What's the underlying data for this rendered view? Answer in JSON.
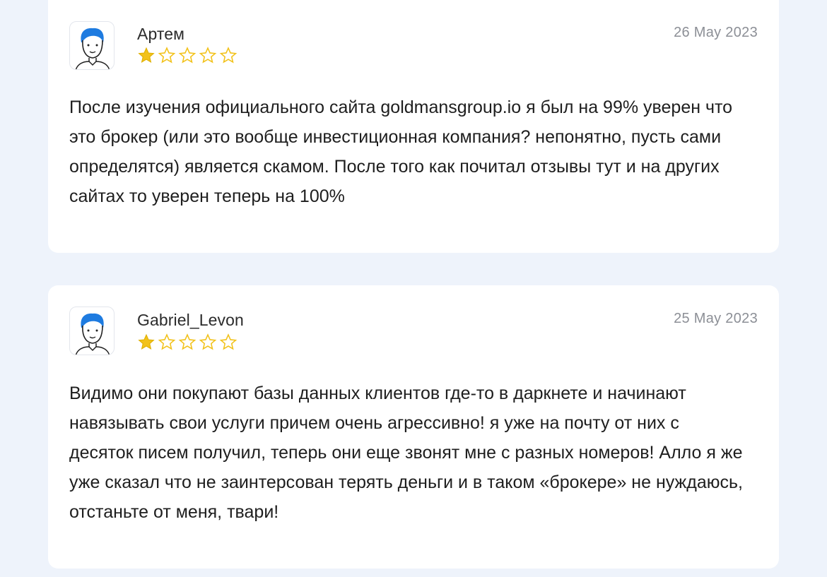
{
  "reviews": [
    {
      "author": "Артем",
      "date": "26 May 2023",
      "rating": 1,
      "max_rating": 5,
      "text": "После изучения официального сайта goldmansgroup.io я был на 99% уверен что это брокер (или это вообще инвестиционная компания? непонятно, пусть сами определятся) является скамом. После того как почитал отзывы тут и на других сайтах то уверен теперь на 100%"
    },
    {
      "author": "Gabriel_Levon",
      "date": "25 May 2023",
      "rating": 1,
      "max_rating": 5,
      "text": "Видимо они покупают базы данных клиентов где-то в даркнете и начинают навязывать свои услуги причем очень агрессивно! я уже на почту от них с десяток писем получил, теперь они еще звонят мне с разных номеров! Алло я же уже сказал что не заинтерсован терять деньги и в таком «брокере» не нуждаюсь, отстаньте от меня, твари!"
    }
  ],
  "icons": {
    "avatar": "user-avatar-icon",
    "star_filled": "star-filled-icon",
    "star_empty": "star-outline-icon"
  },
  "colors": {
    "page_background": "#eef3fb",
    "card_background": "#ffffff",
    "star": "#f2c21b",
    "avatar_hair": "#1e7be0",
    "date_text": "#8c8f96",
    "body_text": "#1e1e1e"
  }
}
